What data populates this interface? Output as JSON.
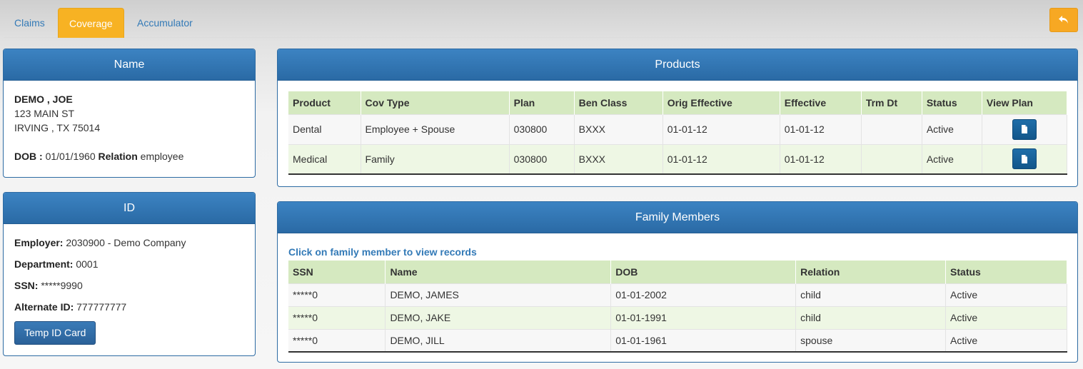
{
  "tabs": [
    {
      "label": "Claims",
      "active": false
    },
    {
      "label": "Coverage",
      "active": true
    },
    {
      "label": "Accumulator",
      "active": false
    }
  ],
  "back_icon": "undo-arrow-icon",
  "name_panel": {
    "title": "Name",
    "member_name": "DEMO , JOE",
    "address1": "123 MAIN ST",
    "address2": "IRVING , TX 75014",
    "dob_label": "DOB :",
    "dob": "01/01/1960",
    "relation_label": "Relation",
    "relation": "employee"
  },
  "id_panel": {
    "title": "ID",
    "employer_label": "Employer:",
    "employer": "2030900 - Demo Company",
    "department_label": "Department:",
    "department": "0001",
    "ssn_label": "SSN:",
    "ssn": "*****9990",
    "alt_id_label": "Alternate ID:",
    "alt_id": "777777777",
    "temp_card_button": "Temp ID Card"
  },
  "products_panel": {
    "title": "Products",
    "columns": [
      "Product",
      "Cov Type",
      "Plan",
      "Ben Class",
      "Orig Effective",
      "Effective",
      "Trm Dt",
      "Status",
      "View Plan"
    ],
    "rows": [
      {
        "product": "Dental",
        "cov_type": "Employee + Spouse",
        "plan": "030800",
        "ben_class": "BXXX",
        "orig_effective": "01-01-12",
        "effective": "01-01-12",
        "trm_dt": "",
        "status": "Active"
      },
      {
        "product": "Medical",
        "cov_type": "Family",
        "plan": "030800",
        "ben_class": "BXXX",
        "orig_effective": "01-01-12",
        "effective": "01-01-12",
        "trm_dt": "",
        "status": "Active"
      }
    ],
    "view_icon": "document-icon"
  },
  "family_panel": {
    "title": "Family Members",
    "hint": "Click on family member to view records",
    "columns": [
      "SSN",
      "Name",
      "DOB",
      "Relation",
      "Status"
    ],
    "rows": [
      {
        "ssn": "*****0",
        "name": "DEMO, JAMES",
        "dob": "01-01-2002",
        "relation": "child",
        "status": "Active"
      },
      {
        "ssn": "*****0",
        "name": "DEMO, JAKE",
        "dob": "01-01-1991",
        "relation": "child",
        "status": "Active"
      },
      {
        "ssn": "*****0",
        "name": "DEMO, JILL",
        "dob": "01-01-1961",
        "relation": "spouse",
        "status": "Active"
      }
    ]
  },
  "colors": {
    "accent_orange": "#f7b223",
    "panel_header_blue": "#2f73b2",
    "table_header_green": "#d5e9c0",
    "link_blue": "#337ab7"
  }
}
